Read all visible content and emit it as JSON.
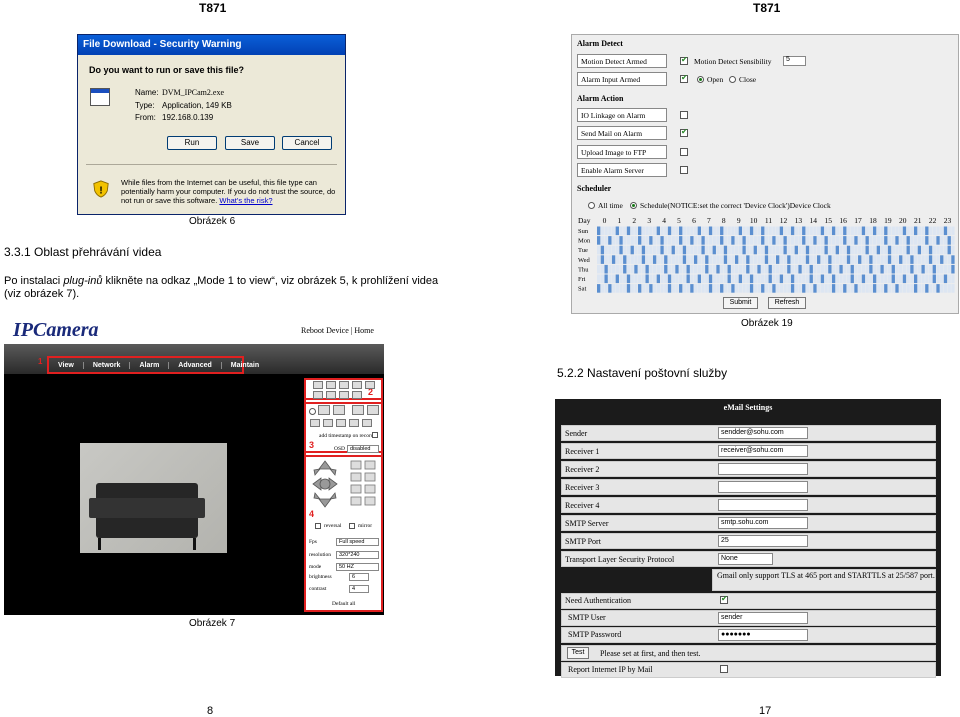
{
  "header": {
    "left": "T871",
    "right": "T871"
  },
  "security_dialog": {
    "title": "File Download - Security Warning",
    "question": "Do you want to run or save this file?",
    "name_label": "Name:",
    "name_value": "DVM_IPCam2.exe",
    "type_label": "Type:",
    "type_value": "Application, 149 KB",
    "from_label": "From:",
    "from_value": "192.168.0.139",
    "run": "Run",
    "save": "Save",
    "cancel": "Cancel",
    "warning": "While files from the Internet can be useful, this file type can potentially harm your computer. If you do not trust the source, do not run or save this software.",
    "risk_link": "What's the risk?"
  },
  "caption6": "Obrázek 6",
  "section": "3.3.1  Oblast přehrávání videa",
  "para_pre": "Po instalaci ",
  "para_em": "plug-inů",
  "para_post": " klikněte na odkaz „Mode 1 to view“, viz obrázek 5, k prohlížení videa (viz obrázek 7).",
  "ipcam": {
    "logo": "IPCamera",
    "topnav": "Reboot Device | Home",
    "menu": [
      "View",
      "Network",
      "Alarm",
      "Advanced",
      "Maintain"
    ],
    "marks": [
      "1",
      "2",
      "3",
      "4"
    ],
    "timestamp_label": "add timestamp on record",
    "osd_label": "OSD",
    "osd_value": "disabled",
    "reversal": "reversal",
    "mirror": "mirror",
    "fps_label": "Fps",
    "fps_value": "Full speed",
    "res_label": "resolution",
    "res_value": "320*240",
    "mode_label": "mode",
    "mode_value": "50 HZ",
    "brightness_label": "brightness",
    "brightness_value": "6",
    "contrast_label": "contrast",
    "contrast_value": "4",
    "default_all": "Default all"
  },
  "caption7": "Obrázek 7",
  "alarm": {
    "detect_hdr": "Alarm Detect",
    "motion_armed": "Motion Detect Armed",
    "sensitivity_label": "Motion Detect Sensibility",
    "sensitivity_value": "5",
    "input_armed": "Alarm Input Armed",
    "open": "Open",
    "close": "Close",
    "action_hdr": "Alarm Action",
    "io_linkage": "IO Linkage on Alarm",
    "send_mail": "Send Mail on Alarm",
    "upload_ftp": "Upload Image to FTP",
    "enable_server": "Enable Alarm Server",
    "scheduler_hdr": "Scheduler",
    "all_time": "All time",
    "schedule_text": "Schedule(NOTICE:set the correct 'Device Clock')Device Clock",
    "day_label": "Day",
    "days": [
      "Sun",
      "Mon",
      "Tue",
      "Wed",
      "Thu",
      "Fri",
      "Sat"
    ],
    "hours": [
      "0",
      "1",
      "2",
      "3",
      "4",
      "5",
      "6",
      "7",
      "8",
      "9",
      "10",
      "11",
      "12",
      "13",
      "14",
      "15",
      "16",
      "17",
      "18",
      "19",
      "20",
      "21",
      "22",
      "23"
    ],
    "submit": "Submit",
    "refresh": "Refresh"
  },
  "caption19": "Obrázek 19",
  "section2": "5.2.2  Nastavení poštovní služby",
  "email": {
    "title": "eMail Settings",
    "rows": [
      {
        "label": "Sender",
        "value": "sendder@sohu.com"
      },
      {
        "label": "Receiver 1",
        "value": "receiver@sohu.com"
      },
      {
        "label": "Receiver 2",
        "value": ""
      },
      {
        "label": "Receiver 3",
        "value": ""
      },
      {
        "label": "Receiver 4",
        "value": ""
      },
      {
        "label": "SMTP Server",
        "value": "smtp.sohu.com"
      },
      {
        "label": "SMTP Port",
        "value": "25"
      }
    ],
    "tls_label": "Transport Layer Security Protocol",
    "tls_value": "None",
    "tls_note": "Gmail only support TLS at 465 port and STARTTLS at 25/587 port.",
    "need_auth": "Need Authentication",
    "smtp_user_label": "SMTP User",
    "smtp_user_value": "sender",
    "smtp_pw_label": "SMTP Password",
    "smtp_pw_value": "●●●●●●●",
    "test": "Test",
    "test_note": "Please set at first, and then test.",
    "report_ip": "Report Internet IP by Mail"
  },
  "page_left": "8",
  "page_right": "17"
}
